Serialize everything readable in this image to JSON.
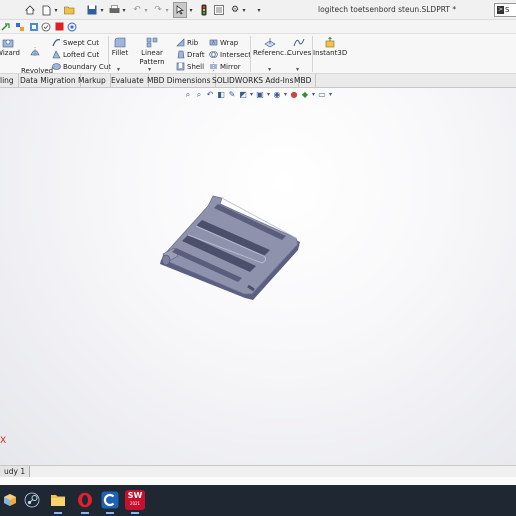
{
  "window": {
    "title": "logitech toetsenbord steun.SLDPRT *",
    "search_prefix": ">",
    "search_text": "S"
  },
  "ribbon": {
    "wizard": "Wizard",
    "revolved_cut": "Revolved\nCut",
    "swept_cut": "Swept Cut",
    "lofted_cut": "Lofted Cut",
    "boundary_cut": "Boundary Cut",
    "fillet": "Fillet",
    "linear_pattern": "Linear Pattern",
    "rib": "Rib",
    "draft": "Draft",
    "shell": "Shell",
    "wrap": "Wrap",
    "intersect": "Intersect",
    "mirror": "Mirror",
    "reference": "Referenc...",
    "curves": "Curves",
    "instant3d": "Instant3D"
  },
  "tabs": [
    {
      "label": "ling"
    },
    {
      "label": "Data Migration"
    },
    {
      "label": "Markup"
    },
    {
      "label": "Evaluate"
    },
    {
      "label": "MBD Dimensions"
    },
    {
      "label": "SOLIDWORKS Add-Ins"
    },
    {
      "label": "MBD"
    }
  ],
  "viewport": {
    "triad_label": "X"
  },
  "bottom": {
    "study_tab": "udy 1"
  },
  "taskbar": {
    "apps": [
      {
        "name": "windows-start"
      },
      {
        "name": "steam"
      },
      {
        "name": "file-explorer"
      },
      {
        "name": "opera"
      },
      {
        "name": "cura"
      },
      {
        "name": "solidworks"
      }
    ],
    "solidworks_badge": "SW",
    "solidworks_year": "2021"
  },
  "colors": {
    "part": "#8e92ad",
    "part_dark": "#5c6080",
    "taskbar": "#1f2733",
    "solidworks_red": "#c8102e",
    "opera_red": "#e0202a",
    "cura_blue": "#1d61b8"
  }
}
